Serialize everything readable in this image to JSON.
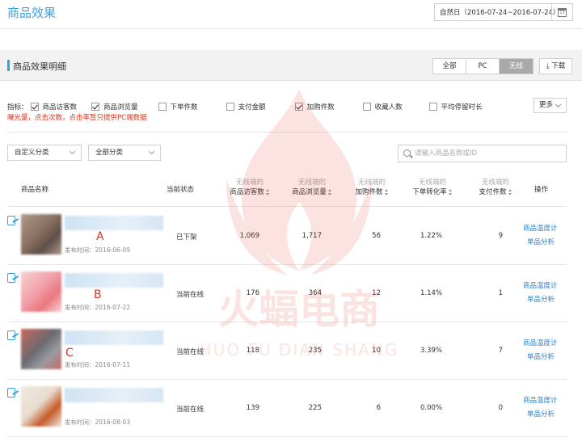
{
  "header": {
    "title": "商品效果",
    "date_range": "自然日（2016-07-24~2016-07-24）",
    "calendar_day": "15"
  },
  "section": {
    "title": "商品效果明细",
    "tabs": [
      "全部",
      "PC",
      "无线"
    ],
    "active_tab": "无线",
    "download_label": "下载"
  },
  "metrics": {
    "label": "指标：",
    "items": [
      {
        "label": "商品访客数",
        "checked": true
      },
      {
        "label": "商品浏览量",
        "checked": true
      },
      {
        "label": "下单件数",
        "checked": false
      },
      {
        "label": "支付金额",
        "checked": false
      },
      {
        "label": "加购件数",
        "checked": true
      },
      {
        "label": "收藏人数",
        "checked": false
      },
      {
        "label": "平均停留时长",
        "checked": false
      }
    ],
    "more_label": "更多",
    "warning": "曝光量，点击次数，点击率暂只提供PC端数据"
  },
  "filters": {
    "custom_category": "自定义分类",
    "all_category": "全部分类",
    "search_placeholder": "请输入商品名称或ID"
  },
  "table": {
    "headers": {
      "name": "商品名称",
      "status": "当前状态",
      "visitors_sub": "无线端的",
      "visitors": "商品访客数",
      "views_sub": "无线端的",
      "views": "商品浏览量",
      "cart_sub": "无线端的",
      "cart": "加购件数",
      "conversion_sub": "无线端的",
      "conversion": "下单转化率",
      "paid_sub": "无线端的",
      "paid": "支付件数",
      "action": "操作"
    },
    "rows": [
      {
        "published": "发布时间：2016-06-09",
        "status": "已下架",
        "visitors": "1,069",
        "views": "1,717",
        "cart": "56",
        "conversion": "1.22%",
        "paid": "9",
        "op1": "商品温度计",
        "op2": "单品分析",
        "marker": "A",
        "thumb_colors": [
          "#8a7060",
          "#5e4f48",
          "#b09a8a"
        ]
      },
      {
        "published": "发布时间：2016-07-22",
        "status": "当前在线",
        "visitors": "176",
        "views": "364",
        "cart": "12",
        "conversion": "1.14%",
        "paid": "1",
        "op1": "商品温度计",
        "op2": "单品分析",
        "marker": "B",
        "thumb_colors": [
          "#f0a0a8",
          "#e87880",
          "#f8d0d0"
        ]
      },
      {
        "published": "发布时间：2016-07-11",
        "status": "当前在线",
        "visitors": "118",
        "views": "235",
        "cart": "10",
        "conversion": "3.39%",
        "paid": "7",
        "op1": "商品温度计",
        "op2": "单品分析",
        "marker": "C",
        "thumb_colors": [
          "#6a6a70",
          "#9a9aa0",
          "#c86860"
        ]
      },
      {
        "published": "发布时间：2016-08-03",
        "status": "当前在线",
        "visitors": "139",
        "views": "225",
        "cart": "6",
        "conversion": "0.00%",
        "paid": "0",
        "op1": "商品温度计",
        "op2": "单品分析",
        "marker": "",
        "thumb_colors": [
          "#e8dcd0",
          "#c85a2a",
          "#f0e8e0"
        ]
      }
    ]
  },
  "watermark": {
    "cn": "火蝠电商",
    "en": "HUO FU DIAN SHANG",
    "color": "#e0321e"
  }
}
